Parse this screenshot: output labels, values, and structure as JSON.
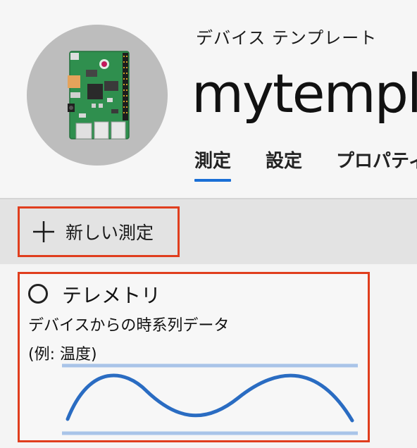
{
  "header": {
    "eyebrow": "デバイス テンプレート",
    "title": "mytemplate"
  },
  "tabs": [
    {
      "label": "測定",
      "active": true
    },
    {
      "label": "設定",
      "active": false
    },
    {
      "label": "プロパティ",
      "active": false
    }
  ],
  "toolbar": {
    "new_measure_label": "新しい測定",
    "new_measure_icon": "plus-icon"
  },
  "card": {
    "title": "テレメトリ",
    "description": "デバイスからの時系列データ",
    "example": "(例: 温度)",
    "selected": false,
    "illustration_icon": "sine-wave-icon"
  },
  "colors": {
    "accent": "#1a6fd6",
    "highlight_border": "#e03e1e",
    "wave_line": "#2a6cc2",
    "wave_guides": "#a9c4e8",
    "avatar_bg": "#bdbdbd"
  }
}
